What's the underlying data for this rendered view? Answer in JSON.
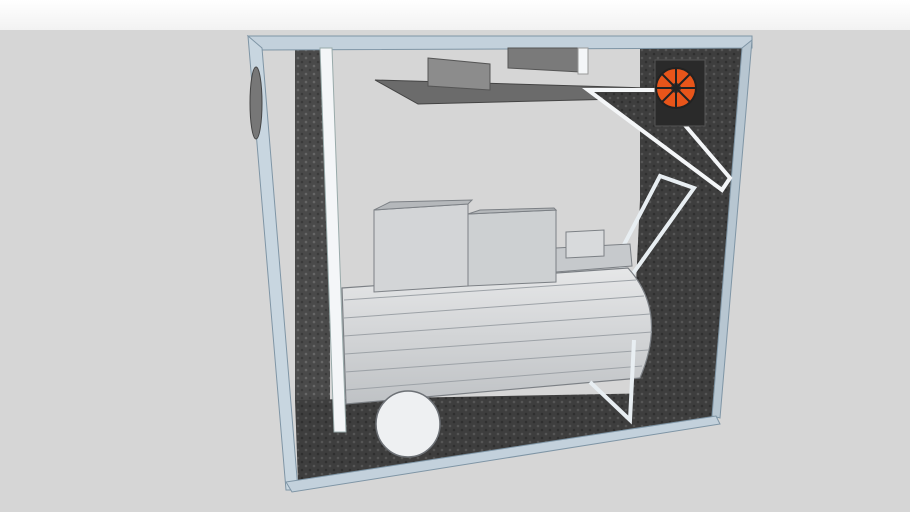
{
  "viewport": {
    "background": "#d6d6d6",
    "top_strip": "#f6f6f6"
  },
  "model": {
    "subject": "enclosure-with-air-compressor",
    "colors": {
      "frame": "#b9c8d4",
      "frame_edge": "#8aa0b0",
      "foam_panel": "#3c3c3c",
      "tank": "#d2d4d6",
      "motor_box": "#cfd1d3",
      "fan_blades": "#e8551a",
      "shelf": "#6c6c6c"
    },
    "icons": [
      "fan-icon",
      "vent-grille-icon",
      "wheel-icon"
    ]
  }
}
